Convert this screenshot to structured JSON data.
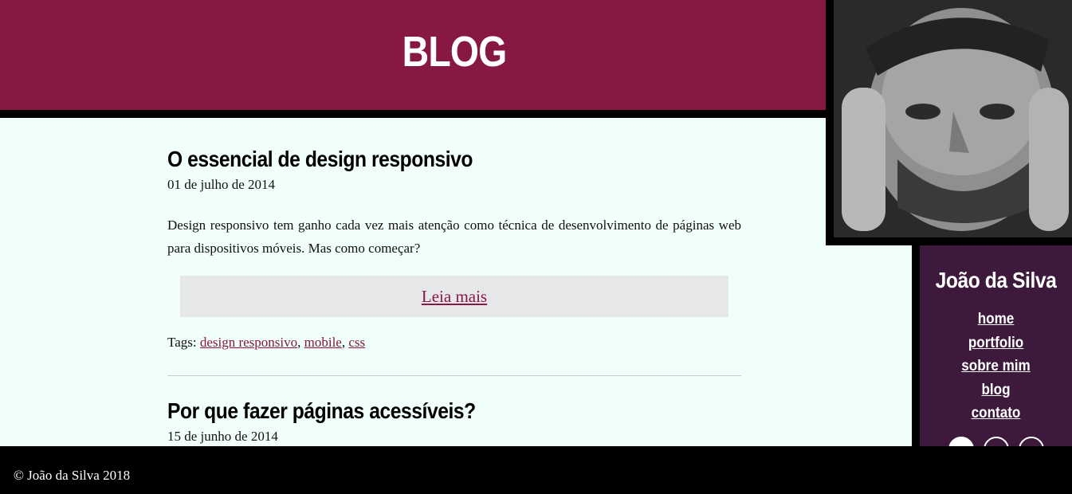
{
  "header": {
    "title": "BLOG"
  },
  "profile": {
    "name": "João da Silva"
  },
  "nav": {
    "items": [
      "home",
      "portfolio",
      "sobre mim",
      "blog",
      "contato"
    ]
  },
  "social": {
    "icons": [
      "github-icon",
      "facebook-icon",
      "linkedin-icon"
    ]
  },
  "posts": [
    {
      "title": "O essencial de design responsivo",
      "date": "01 de julho de 2014",
      "excerpt": "Design responsivo tem ganho cada vez mais atenção como técnica de desenvolvimento de páginas web para dispositivos móveis. Mas como começar?",
      "read_more": "Leia mais",
      "tags_label": "Tags:",
      "tags": [
        "design responsivo",
        "mobile",
        "css"
      ]
    },
    {
      "title": "Por que fazer páginas acessíveis?",
      "date": "15 de junho de 2014"
    }
  ],
  "footer": {
    "text": "© João da Silva 2018"
  },
  "colors": {
    "header": "#871743",
    "sidebar": "#3d1a3c",
    "background": "#f1fffa",
    "link": "#871743",
    "footer": "#000000"
  }
}
